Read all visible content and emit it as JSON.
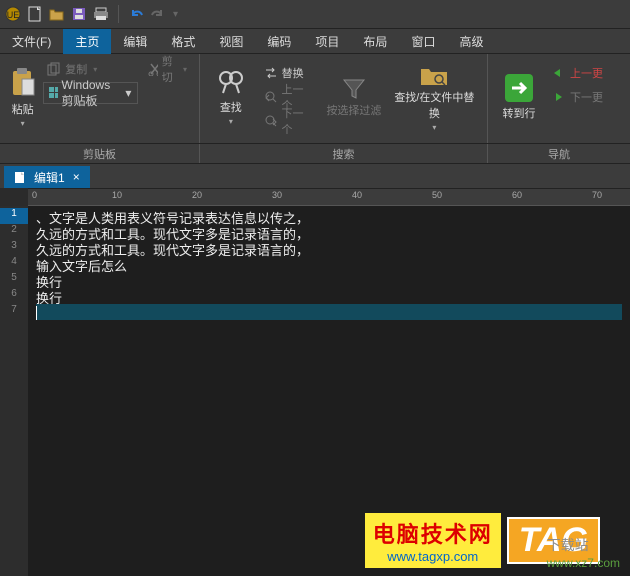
{
  "titlebar": {
    "icons": [
      "app",
      "new",
      "open",
      "save",
      "print",
      "undo",
      "redo"
    ]
  },
  "menu": {
    "items": [
      "文件(F)",
      "主页",
      "编辑",
      "格式",
      "视图",
      "编码",
      "项目",
      "布局",
      "窗口",
      "高级"
    ],
    "active": 1
  },
  "ribbon": {
    "clipboard": {
      "paste": "粘贴",
      "copy": "复制",
      "cut": "剪切",
      "combo": "Windows 剪贴板",
      "label": "剪贴板"
    },
    "search": {
      "find": "查找",
      "replace": "替换",
      "prev": "上一个",
      "next": "下一个",
      "filter": "按选择过滤",
      "findInFiles": "查找/在文件中替换",
      "label": "搜索"
    },
    "nav": {
      "goto": "转到行",
      "prevEdit": "上一更",
      "nextEdit": "下一更",
      "label": "导航"
    }
  },
  "tab": {
    "name": "编辑1",
    "close": "×"
  },
  "ruler": {
    "ticks": [
      0,
      10,
      20,
      30,
      40,
      50,
      60,
      70
    ]
  },
  "gutter": {
    "lines": [
      "1",
      "2",
      "3",
      "4",
      "5",
      "6",
      "7"
    ],
    "current": 7
  },
  "code": {
    "lines": [
      "、文字是人类用表义符号记录表达信息以传之，",
      "久远的方式和工具。现代文字多是记录语言的，",
      "久远的方式和工具。现代文字多是记录语言的，",
      "输入文字后怎么",
      "换行",
      "换行",
      ""
    ]
  },
  "watermark": {
    "site1_title": "电脑技术网",
    "site1_url": "www.tagxp.com",
    "tag": "TAG",
    "site2_a": "下载站",
    "site2_b": "www.xz7.com"
  }
}
